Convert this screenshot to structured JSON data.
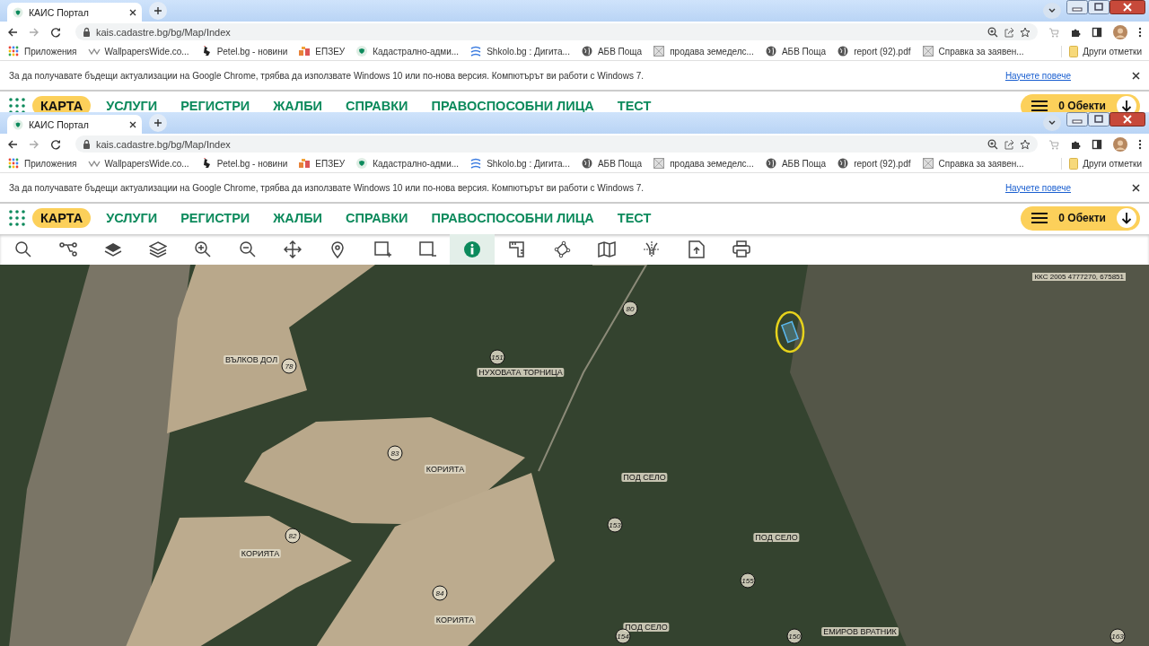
{
  "windows": [
    {
      "tab": {
        "title": "КАИС Портал"
      },
      "address": {
        "url": "kais.cadastre.bg/bg/Map/Index"
      },
      "bookmarks": [
        {
          "label": "Приложения"
        },
        {
          "label": "WallpapersWide.co..."
        },
        {
          "label": "Petel.bg - новини"
        },
        {
          "label": "ЕПЗЕУ"
        },
        {
          "label": "Кадастрално-адми..."
        },
        {
          "label": "Shkolo.bg : Дигита..."
        },
        {
          "label": "АБВ Поща"
        },
        {
          "label": "продава земеделс..."
        },
        {
          "label": "АБВ Поща"
        },
        {
          "label": "report (92).pdf"
        },
        {
          "label": "Справка за заявен..."
        }
      ],
      "other_bookmarks": "Други отметки",
      "infobar": {
        "message": "За да получавате бъдещи актуализации на Google Chrome, трябва да използвате Windows 10 или по-нова версия. Компютърът ви работи с Windows 7.",
        "link": "Научете повече"
      },
      "nav": {
        "items": [
          {
            "label": "КАРТА",
            "selected": true
          },
          {
            "label": "УСЛУГИ",
            "selected": false
          },
          {
            "label": "РЕГИСТРИ",
            "selected": false
          },
          {
            "label": "ЖАЛБИ",
            "selected": false
          },
          {
            "label": "СПРАВКИ",
            "selected": false
          },
          {
            "label": "ПРАВОСПОСОБНИ ЛИЦА",
            "selected": false
          },
          {
            "label": "ТЕСТ",
            "selected": false
          }
        ],
        "objects_button": "0 Обекти"
      }
    },
    {
      "tab": {
        "title": "КАИС Портал"
      },
      "address": {
        "url": "kais.cadastre.bg/bg/Map/Index"
      },
      "bookmarks": [
        {
          "label": "Приложения"
        },
        {
          "label": "WallpapersWide.co..."
        },
        {
          "label": "Petel.bg - новини"
        },
        {
          "label": "ЕПЗЕУ"
        },
        {
          "label": "Кадастрално-адми..."
        },
        {
          "label": "Shkolo.bg : Дигита..."
        },
        {
          "label": "АБВ Поща"
        },
        {
          "label": "продава земеделс..."
        },
        {
          "label": "АБВ Поща"
        },
        {
          "label": "report (92).pdf"
        },
        {
          "label": "Справка за заявен..."
        }
      ],
      "other_bookmarks": "Други отметки",
      "infobar": {
        "message": "За да получавате бъдещи актуализации на Google Chrome, трябва да използвате Windows 10 или по-нова версия. Компютърът ви работи с Windows 7.",
        "link": "Научете повече"
      },
      "nav": {
        "items": [
          {
            "label": "КАРТА",
            "selected": true
          },
          {
            "label": "УСЛУГИ",
            "selected": false
          },
          {
            "label": "РЕГИСТРИ",
            "selected": false
          },
          {
            "label": "ЖАЛБИ",
            "selected": false
          },
          {
            "label": "СПРАВКИ",
            "selected": false
          },
          {
            "label": "ПРАВОСПОСОБНИ ЛИЦА",
            "selected": false
          },
          {
            "label": "ТЕСТ",
            "selected": false
          }
        ],
        "objects_button": "0 Обекти"
      },
      "toolbar": {
        "tools": [
          {
            "selected": false
          },
          {
            "selected": false
          },
          {
            "selected": false
          },
          {
            "selected": false
          },
          {
            "selected": false
          },
          {
            "selected": false
          },
          {
            "selected": false
          },
          {
            "selected": false
          },
          {
            "selected": false
          },
          {
            "selected": false
          },
          {
            "selected": true
          },
          {
            "selected": false
          },
          {
            "selected": false
          },
          {
            "selected": false
          },
          {
            "selected": false
          },
          {
            "selected": false
          },
          {
            "selected": false
          }
        ]
      },
      "map": {
        "coordinates": "ККС 2005 4777270, 675851",
        "labels": [
          {
            "kind": "place",
            "text": "ВЪЛКОВ ДОЛ"
          },
          {
            "kind": "parcel",
            "text": "78"
          },
          {
            "kind": "parcel",
            "text": "151"
          },
          {
            "kind": "place",
            "text": "НУХОВАТА ТОРНИЦА"
          },
          {
            "kind": "parcel",
            "text": "80"
          },
          {
            "kind": "parcel",
            "text": "83"
          },
          {
            "kind": "place",
            "text": "КОРИЯТА"
          },
          {
            "kind": "parcel",
            "text": "82"
          },
          {
            "kind": "place",
            "text": "КОРИЯТА"
          },
          {
            "kind": "parcel",
            "text": "84"
          },
          {
            "kind": "place",
            "text": "КОРИЯТА"
          },
          {
            "kind": "place",
            "text": "ПОД СЕЛО"
          },
          {
            "kind": "parcel",
            "text": "153"
          },
          {
            "kind": "place",
            "text": "ПОД СЕЛО"
          },
          {
            "kind": "parcel",
            "text": "155"
          },
          {
            "kind": "place",
            "text": "ПОД СЕЛО"
          },
          {
            "kind": "parcel",
            "text": "154"
          },
          {
            "kind": "parcel",
            "text": "150"
          },
          {
            "kind": "place",
            "text": "ЕМИРОВ ВРАТНИК"
          },
          {
            "kind": "parcel",
            "text": "163"
          }
        ]
      }
    }
  ]
}
